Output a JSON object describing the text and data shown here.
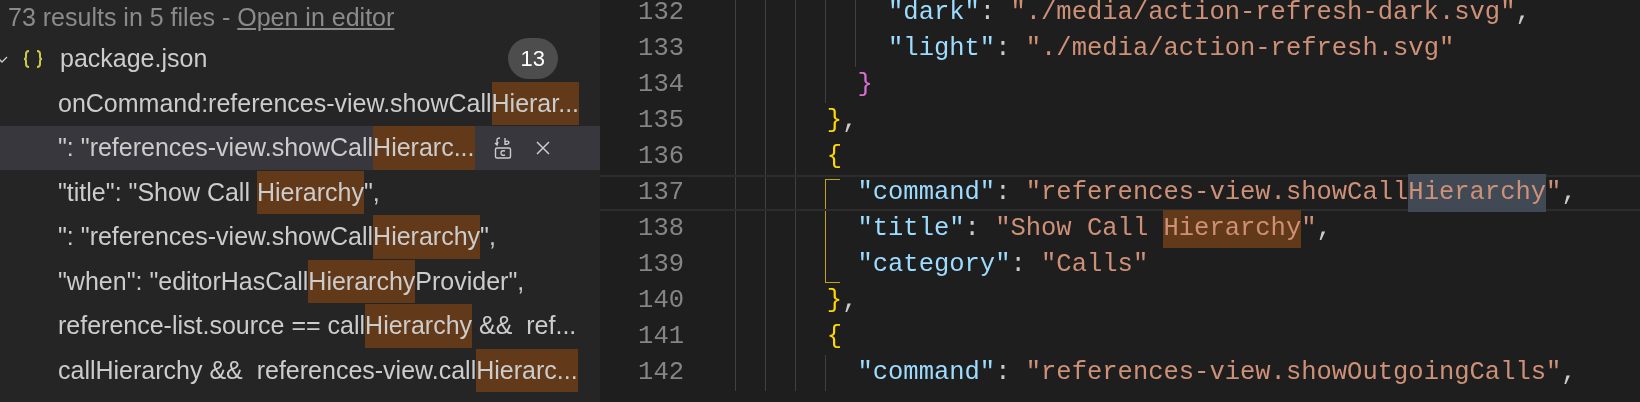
{
  "search_results": {
    "summary": "73 results in 5 files - ",
    "link": "Open in editor",
    "file": {
      "name": "package.json",
      "count": "13",
      "expanded": true,
      "matches": [
        {
          "selected": false,
          "parts": [
            {
              "text": "onCommand:references-view.showCall",
              "match": false
            },
            {
              "text": "Hierar...",
              "match": true
            }
          ]
        },
        {
          "selected": true,
          "parts": [
            {
              "text": "\": \"references-view.showCall",
              "match": false
            },
            {
              "text": "Hierarc...",
              "match": true
            }
          ]
        },
        {
          "selected": false,
          "parts": [
            {
              "text": "\"title\": \"Show Call ",
              "match": false
            },
            {
              "text": "Hierarchy",
              "match": true
            },
            {
              "text": "\",",
              "match": false
            }
          ]
        },
        {
          "selected": false,
          "parts": [
            {
              "text": "\": \"references-view.showCall",
              "match": false
            },
            {
              "text": "Hierarchy",
              "match": true
            },
            {
              "text": "\",",
              "match": false
            }
          ]
        },
        {
          "selected": false,
          "parts": [
            {
              "text": "\"when\": \"editorHasCall",
              "match": false
            },
            {
              "text": "Hierarchy",
              "match": true
            },
            {
              "text": "Provider\",",
              "match": false
            }
          ]
        },
        {
          "selected": false,
          "parts": [
            {
              "text": "reference-list.source == call",
              "match": false
            },
            {
              "text": "Hierarchy",
              "match": true
            },
            {
              "text": " &&  ref...",
              "match": false
            }
          ]
        },
        {
          "selected": false,
          "parts": [
            {
              "text": "callHierarchy &&  references-view.call",
              "match": false
            },
            {
              "text": "Hierarc...",
              "match": true
            }
          ]
        }
      ]
    }
  },
  "editor": {
    "lines": [
      {
        "number": "132",
        "current": false,
        "tokens": [
          {
            "text": "          \"dark\"",
            "kind": "key"
          },
          {
            "text": ": ",
            "kind": "punct"
          },
          {
            "text": "\"./media/action-refresh-dark.svg\"",
            "kind": "string"
          },
          {
            "text": ",",
            "kind": "punct"
          }
        ]
      },
      {
        "number": "133",
        "current": false,
        "tokens": [
          {
            "text": "          \"light\"",
            "kind": "key"
          },
          {
            "text": ": ",
            "kind": "punct"
          },
          {
            "text": "\"./media/action-refresh.svg\"",
            "kind": "string"
          }
        ]
      },
      {
        "number": "134",
        "current": false,
        "tokens": [
          {
            "text": "        }",
            "kind": "brace2"
          }
        ]
      },
      {
        "number": "135",
        "current": false,
        "tokens": [
          {
            "text": "      }",
            "kind": "brace1"
          },
          {
            "text": ",",
            "kind": "punct"
          }
        ]
      },
      {
        "number": "136",
        "current": false,
        "tokens": [
          {
            "text": "      {",
            "kind": "brace1"
          }
        ]
      },
      {
        "number": "137",
        "current": true,
        "bracket_guide": true,
        "tokens": [
          {
            "text": "        \"command\"",
            "kind": "key"
          },
          {
            "text": ": ",
            "kind": "punct"
          },
          {
            "text": "\"references-view.showCall",
            "kind": "string"
          },
          {
            "text": "Hierarchy",
            "kind": "string",
            "selected": true
          },
          {
            "text": "\"",
            "kind": "string"
          },
          {
            "text": ",",
            "kind": "punct"
          }
        ]
      },
      {
        "number": "138",
        "current": false,
        "bracket_guide": true,
        "tokens": [
          {
            "text": "        \"title\"",
            "kind": "key"
          },
          {
            "text": ": ",
            "kind": "punct"
          },
          {
            "text": "\"Show Call ",
            "kind": "string"
          },
          {
            "text": "Hierarchy",
            "kind": "string",
            "match": true
          },
          {
            "text": "\"",
            "kind": "string"
          },
          {
            "text": ",",
            "kind": "punct"
          }
        ]
      },
      {
        "number": "139",
        "current": false,
        "bracket_guide": true,
        "tokens": [
          {
            "text": "        \"category\"",
            "kind": "key"
          },
          {
            "text": ": ",
            "kind": "punct"
          },
          {
            "text": "\"Calls\"",
            "kind": "string"
          }
        ]
      },
      {
        "number": "140",
        "current": false,
        "tokens": [
          {
            "text": "      }",
            "kind": "brace1"
          },
          {
            "text": ",",
            "kind": "punct"
          }
        ]
      },
      {
        "number": "141",
        "current": false,
        "tokens": [
          {
            "text": "      {",
            "kind": "brace1"
          }
        ]
      },
      {
        "number": "142",
        "current": false,
        "tokens": [
          {
            "text": "        \"command\"",
            "kind": "key"
          },
          {
            "text": ": ",
            "kind": "punct"
          },
          {
            "text": "\"references-view.showOutgoingCalls\"",
            "kind": "string"
          },
          {
            "text": ",",
            "kind": "punct"
          }
        ]
      }
    ]
  }
}
